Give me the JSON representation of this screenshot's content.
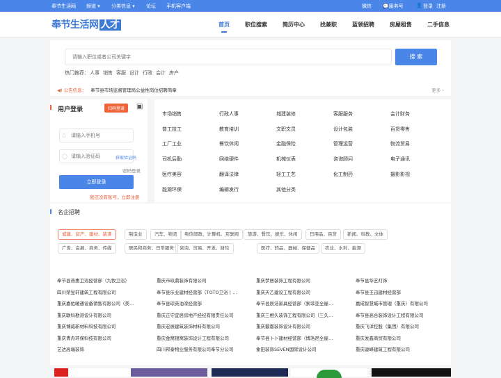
{
  "topbar": {
    "site": "奉节生活网",
    "channel": "频道",
    "classified": "分类信息",
    "forum": "论坛",
    "mobile": "手机客户端",
    "wechat": "微信",
    "service": "服务号",
    "login": "登录",
    "register": "注册"
  },
  "header": {
    "logo_main": "奉节生活网",
    "logo_tag": "人才",
    "nav": [
      "首页",
      "职位搜索",
      "简历中心",
      "找兼职",
      "蓝领招聘",
      "房屋租售",
      "二手信息"
    ]
  },
  "search": {
    "placeholder": "请输入职位或者公司关键字",
    "button": "搜 索",
    "hot_label": "热门推荐：",
    "hot": [
      "人事",
      "销售",
      "客服",
      "设计",
      "行政",
      "会计",
      "房产"
    ]
  },
  "notice": {
    "label": "公告信息：",
    "text": "奉节县市场监督管理局公益性岗位招聘简章",
    "more": "更多 ›"
  },
  "login": {
    "title": "用户登录",
    "scan": "扫码登录",
    "phone_placeholder": "请输入手机号",
    "code_placeholder": "请输入验证码",
    "get_code": "获取验证码",
    "pwd_login": "密码登录",
    "submit": "立即登录",
    "register": "我还没有账号，立即注册"
  },
  "categories": [
    "市场销售",
    "行政人事",
    "城建装修",
    "客服服务",
    "会计财务",
    "普工技工",
    "教育培训",
    "文职文员",
    "设计包装",
    "百货零售",
    "工厂工业",
    "餐饮休闲",
    "金融保险",
    "管理运营",
    "物流贸易",
    "司机后勤",
    "网络硬件",
    "机械仪表",
    "咨询顾问",
    "电子通讯",
    "医疗美容",
    "翻译法律",
    "轻工工艺",
    "化工制药",
    "摄影影视",
    "能源环保",
    "编辑发行",
    "其他分类"
  ],
  "famous": {
    "title": "名企招聘",
    "tags": [
      "城建、房产、建材、装潢",
      "制造业",
      "汽车、物流",
      "电信邮政、计算机、互联网",
      "旅游、餐饮、娱乐、休闲",
      "日用品、百货",
      "新闻、科教、文体",
      "广告、会展、商务、传媒",
      "居民和商务、日常服务",
      "咨询、贸易、开发、财险",
      "医疗、药品、器械、保健品",
      "农业、水利、能源"
    ],
    "companies": [
      "奉节县燕惠卫浴经营部（九牧卫浴）",
      "重庆市玖鼎装饰有限公司",
      "重庆梦居装饰工程有限公司",
      "奉节县华艺灯饰",
      "四川荣昱轩建筑工程有限公司",
      "奉节县乐业建材经营部（TOTO卫浴丨…",
      "重庆天乙建设工程有限公司",
      "奉节县王迅建材经营部",
      "重庆嘉佑暖通设备销售有限公司（美…",
      "奉节县琼英油漆经营部",
      "奉节县辰浩家具经营部（索菲亚全屋…",
      "嘉成智慧城市管理（重庆）有限公司",
      "重庆联科勘测设计有限公司",
      "重庆正守宜居房地产经纪有限责任公司",
      "重庆三橙久装饰工程有限公司（三久…",
      "奉节县高合装饰设计工程有限公司",
      "重庆博威新材料科技有限公司",
      "重庆宏展建筑装饰材料有限公司",
      "重庆蘡都装饰设计有限公司",
      "重庆飞洋控股（集团）有限公司",
      "重庆青舟环保科技有限公司",
      "重庆金窝银窝装饰设计工程有限公司",
      "奉节县卜卜建材经营部（博洛尼全屋…",
      "重庆发鑫商贸有限公司",
      "艺达高端装饰",
      "四川邦泰物业服务有限公司奉节分公司",
      "象田装饰SEVEN国际设计公司",
      "重庆骏峰建筑工程有限公司"
    ]
  }
}
